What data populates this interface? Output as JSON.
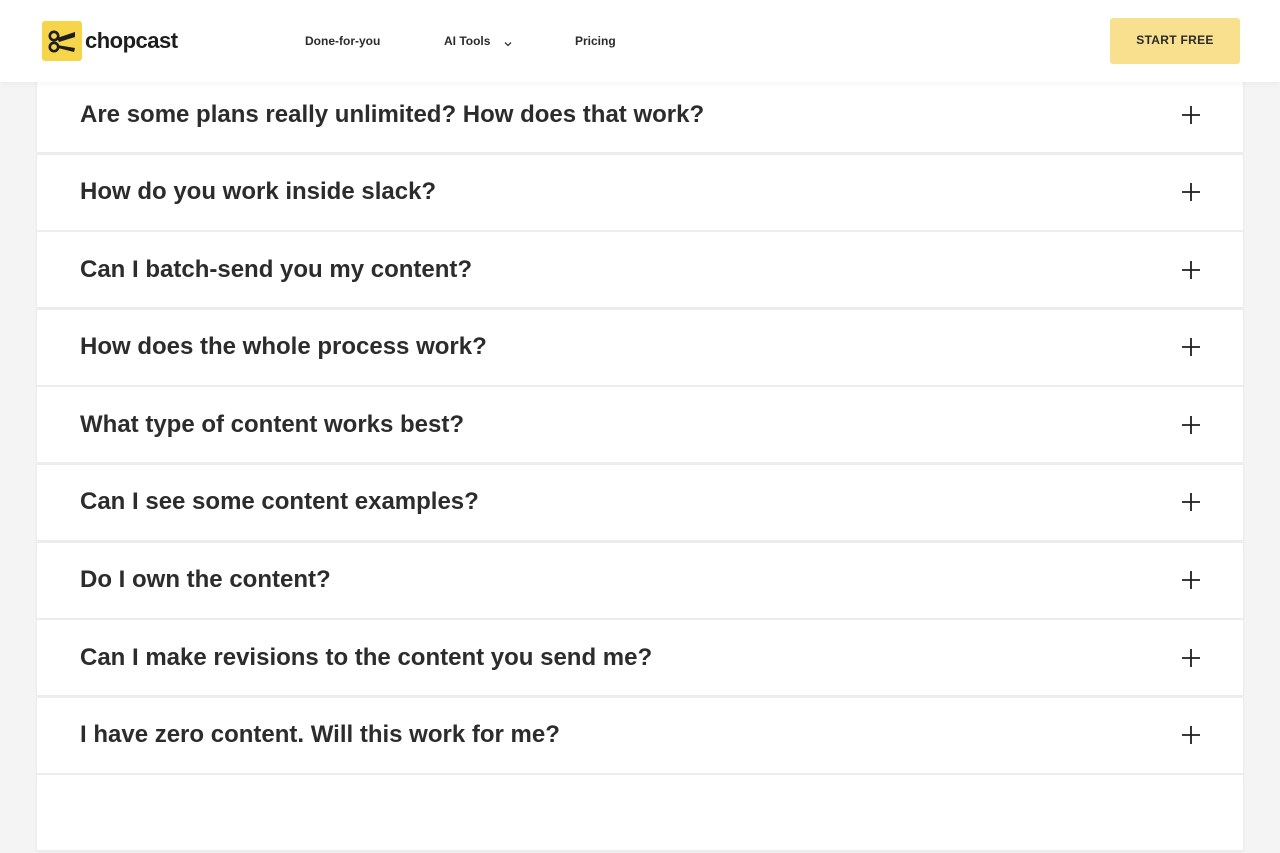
{
  "brand": {
    "name": "chopcast",
    "accent_color": "#f7d54a",
    "cta_color": "#f9e08e"
  },
  "nav": {
    "items": [
      {
        "label": "Done-for-you"
      },
      {
        "label": "AI Tools",
        "has_dropdown": true,
        "icon": "chevron-down-icon"
      },
      {
        "label": "Pricing"
      }
    ],
    "cta_label": "START FREE"
  },
  "faq": {
    "icon": "plus-icon",
    "items": [
      {
        "question": "Are some plans really unlimited? How does that work?"
      },
      {
        "question": "How do you work inside slack?"
      },
      {
        "question": "Can I batch-send you my content?"
      },
      {
        "question": "How does the whole process work?"
      },
      {
        "question": "What type of content works best?"
      },
      {
        "question": "Can I see some content examples?"
      },
      {
        "question": "Do I own the content?"
      },
      {
        "question": "Can I make revisions to the content you send me?"
      },
      {
        "question": "I have zero content. Will this work for me?"
      },
      {
        "question": ""
      }
    ]
  }
}
